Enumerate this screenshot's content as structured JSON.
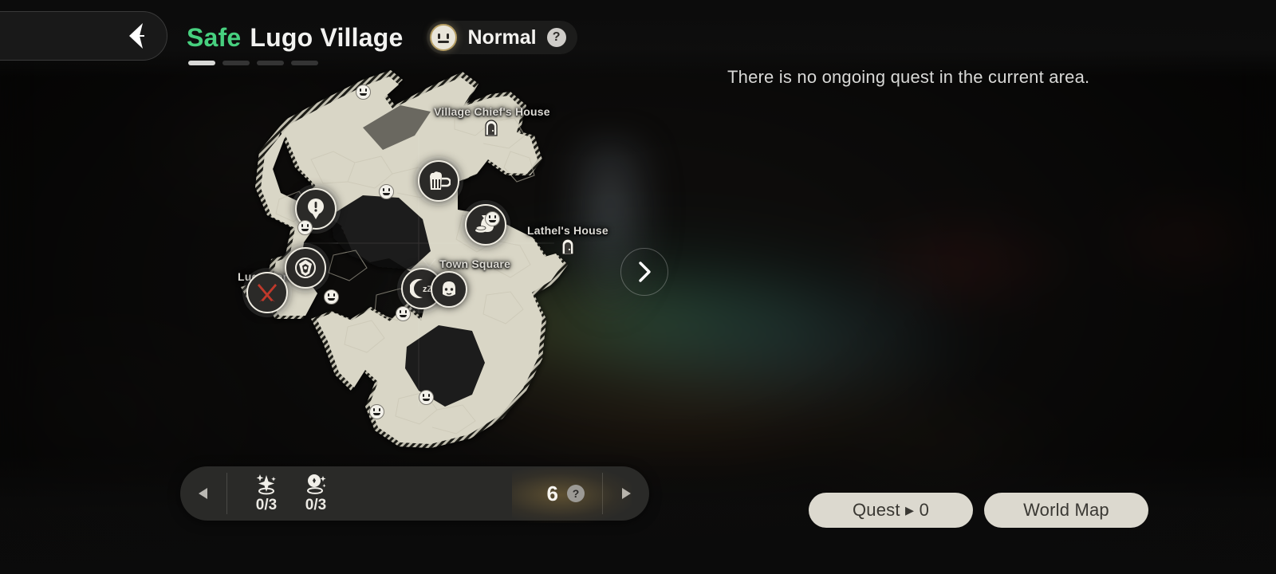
{
  "header": {
    "safety_label": "Safe",
    "area_name": "Lugo Village",
    "difficulty_label": "Normal",
    "help_glyph": "?",
    "difficulty_icon": "neutral-face-icon",
    "pips": [
      {
        "state": "active"
      },
      {
        "state": "inactive"
      },
      {
        "state": "inactive"
      },
      {
        "state": "inactive"
      }
    ]
  },
  "back_button": {
    "icon": "chevron-left-icon"
  },
  "quest_status": {
    "text": "There is no ongoing quest in the current area."
  },
  "next_button": {
    "icon": "chevron-right-icon"
  },
  "map": {
    "labels": [
      {
        "text": "Village Chief's House",
        "icon": "door-icon"
      },
      {
        "text": "Lathel's House",
        "icon": "door-icon"
      },
      {
        "text": "Town Square",
        "icon": "none"
      },
      {
        "text": "Lugo Forest",
        "icon": "crossed-swords-icon"
      }
    ],
    "markers": [
      {
        "name": "quest-pin-marker",
        "icon": "exclamation-pin-icon"
      },
      {
        "name": "tavern-marker",
        "icon": "beer-mug-icon"
      },
      {
        "name": "guild-crest-marker",
        "icon": "crest-icon"
      },
      {
        "name": "merchant-marker",
        "icon": "money-bag-icon"
      },
      {
        "name": "rest-marker",
        "icon": "moon-zz-icon"
      },
      {
        "name": "npc-portrait-marker",
        "icon": "character-portrait-icon"
      },
      {
        "name": "combat-zone-marker",
        "icon": "crossed-swords-icon"
      }
    ],
    "npc_count": 8
  },
  "toolbar": {
    "prev_icon": "triangle-left-icon",
    "next_icon": "triangle-right-icon",
    "counters": [
      {
        "name": "sparkle-counter",
        "icon": "sparkle-star-icon",
        "value": "0/3"
      },
      {
        "name": "discovery-counter",
        "icon": "sparkle-location-icon",
        "value": "0/3"
      }
    ],
    "total_count": "6",
    "help_glyph": "?"
  },
  "actions": {
    "quest_label": "Quest ▸ 0",
    "world_map_label": "World Map"
  },
  "colors": {
    "safe_green": "#47d07f",
    "land_beige": "#d8d5c4",
    "button_cream": "#dcd9cf",
    "accent_gold": "#b59d63",
    "sword_red": "#c0392b"
  }
}
